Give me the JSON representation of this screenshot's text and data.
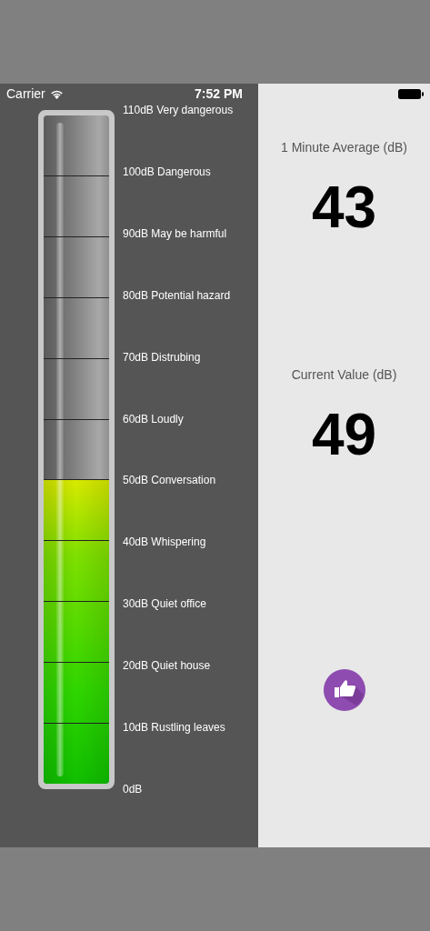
{
  "status_bar": {
    "carrier": "Carrier",
    "time": "7:52 PM"
  },
  "meter": {
    "level": 0.4545,
    "scale_labels": [
      "110dB Very dangerous",
      "100dB Dangerous",
      "90dB May be harmful",
      "80dB Potential hazard",
      "70dB Distrubing",
      "60dB Loudly",
      "50dB Conversation",
      "40dB Whispering",
      "30dB Quiet office",
      "20dB Quiet house",
      "10dB Rustling leaves",
      "0dB"
    ]
  },
  "readings": [
    {
      "label": "1 Minute Average (dB)",
      "value": "43"
    },
    {
      "label": "Current Value (dB)",
      "value": "49"
    }
  ]
}
